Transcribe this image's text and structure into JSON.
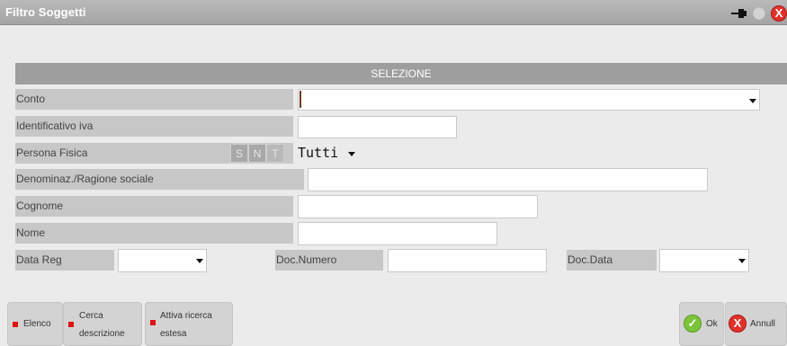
{
  "window": {
    "title": "Filtro Soggetti",
    "close_symbol": "X"
  },
  "section": {
    "title": "SELEZIONE"
  },
  "rows": {
    "conto": {
      "label": "Conto",
      "value": ""
    },
    "identificativo_iva": {
      "label": "Identificativo iva",
      "value": ""
    },
    "persona_fisica": {
      "label": "Persona Fisica",
      "options": [
        "S",
        "N",
        "T"
      ],
      "selected": "Tutti"
    },
    "denominazione": {
      "label": "Denominaz./Ragione sociale",
      "value": ""
    },
    "cognome": {
      "label": "Cognome",
      "value": ""
    },
    "nome": {
      "label": "Nome",
      "value": ""
    },
    "data_reg": {
      "label": "Data Reg",
      "value": ""
    },
    "doc_numero": {
      "label": "Doc.Numero",
      "value": ""
    },
    "doc_data": {
      "label": "Doc.Data",
      "value": ""
    }
  },
  "buttons": {
    "elenco": "Elenco",
    "cerca_descrizione": [
      "Cerca",
      "descrizione"
    ],
    "attiva_ricerca": [
      "Attiva ricerca",
      "estesa"
    ],
    "ok": "Ok",
    "annulla": "Annull",
    "ok_symbol": "✓",
    "annulla_symbol": "X"
  },
  "colors": {
    "title_bar": "#a9a9a9",
    "section_header": "#9e9e9e",
    "label_bg": "#c7c7c7",
    "accent_red": "#e01111",
    "ok_green": "#7cc43a"
  }
}
